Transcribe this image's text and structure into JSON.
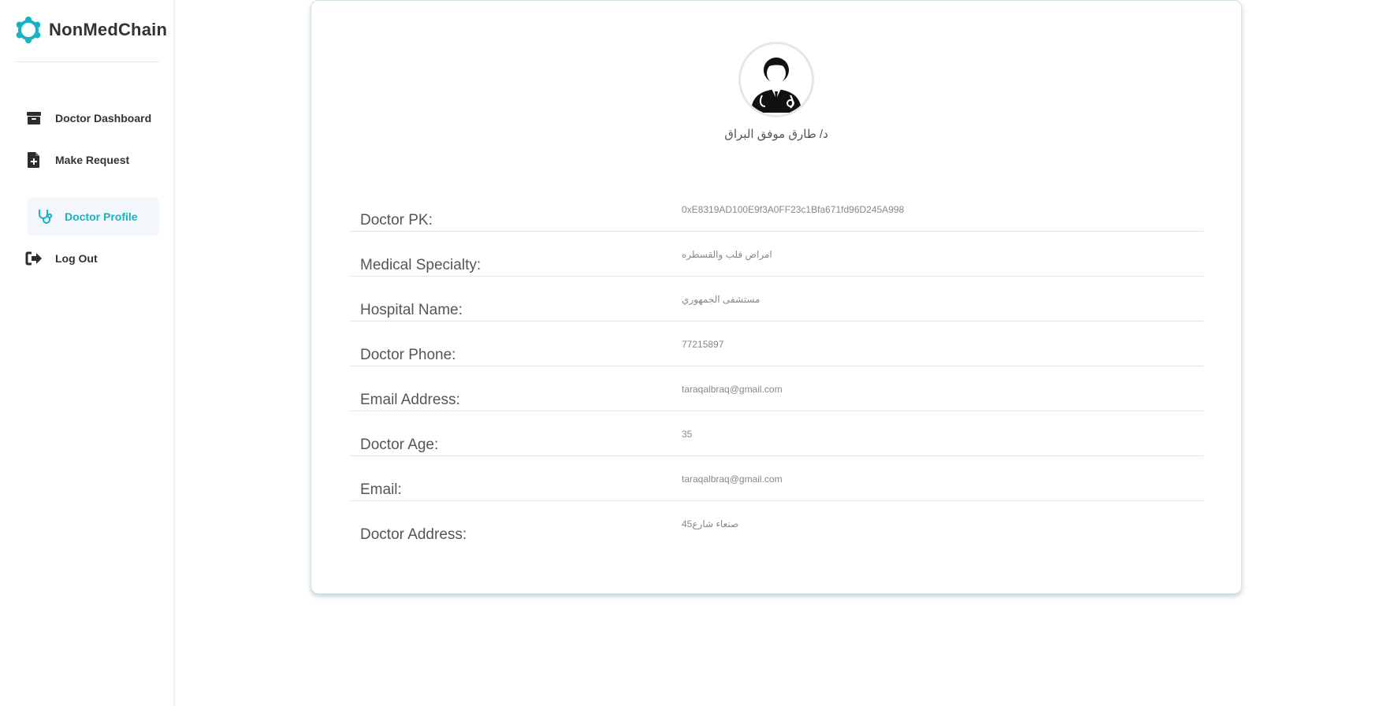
{
  "brand": {
    "name": "NonMedChain"
  },
  "sidebar": {
    "items": [
      {
        "label": "Doctor Dashboard",
        "icon": "archive-box-icon"
      },
      {
        "label": "Make Request",
        "icon": "file-plus-icon"
      },
      {
        "label": "Doctor Profile",
        "icon": "stethoscope-icon",
        "active": true
      },
      {
        "label": "Log Out",
        "icon": "sign-out-icon"
      }
    ]
  },
  "profile": {
    "name": "د/ طارق موفق البراق",
    "fields": [
      {
        "label": "Doctor PK:",
        "value": "0xE8319AD100E9f3A0FF23c1Bfa671fd96D245A998"
      },
      {
        "label": "Medical Specialty:",
        "value": "امراض قلب والقسطره"
      },
      {
        "label": "Hospital Name:",
        "value": "مستشفى الجمهوري"
      },
      {
        "label": "Doctor Phone:",
        "value": "77215897"
      },
      {
        "label": "Email Address:",
        "value": "taraqalbraq@gmail.com"
      },
      {
        "label": "Doctor Age:",
        "value": "35"
      },
      {
        "label": "Email:",
        "value": "taraqalbraq@gmail.com"
      },
      {
        "label": "Doctor Address:",
        "value": "صنعاء شارع45"
      }
    ]
  },
  "colors": {
    "accent": "#17b3c1",
    "text": "#333333",
    "muted": "#888888",
    "active_bg": "#f3f7fb"
  }
}
